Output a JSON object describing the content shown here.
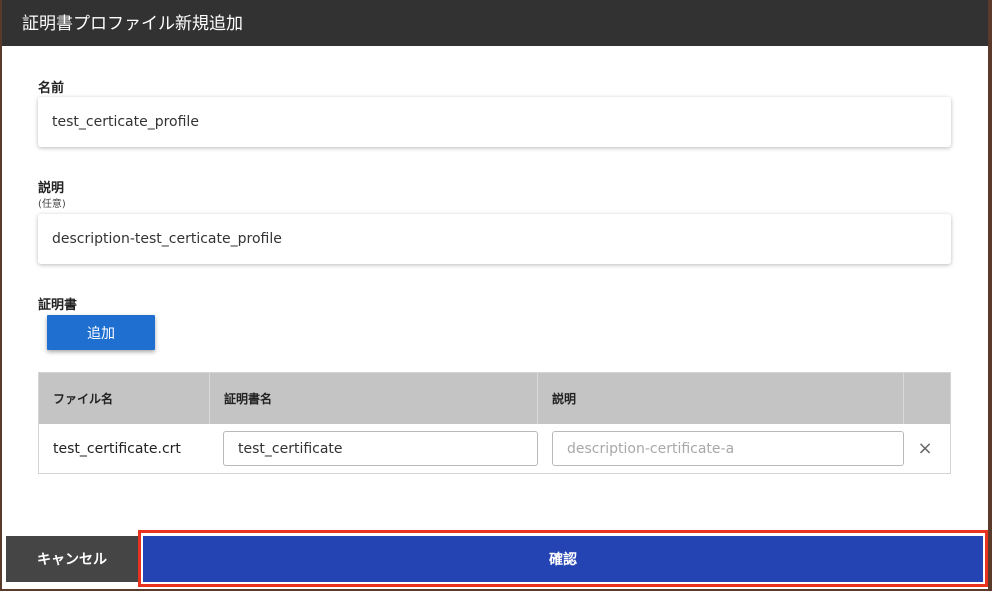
{
  "dialog": {
    "title": "証明書プロファイル新規追加"
  },
  "form": {
    "name": {
      "label": "名前",
      "value": "test_certicate_profile"
    },
    "description": {
      "label": "説明",
      "sublabel": "(任意)",
      "value": "description-test_certicate_profile"
    },
    "certificate": {
      "label": "証明書",
      "add_label": "追加"
    }
  },
  "table": {
    "headers": [
      "ファイル名",
      "証明書名",
      "説明"
    ],
    "rows": [
      {
        "file_name": "test_certificate.crt",
        "cert_name": "test_certificate",
        "description_placeholder": "description-certificate-a",
        "remove_icon": "×"
      }
    ]
  },
  "footer": {
    "cancel_label": "キャンセル",
    "confirm_label": "確認",
    "confirm_highlight_color": "#e8321f"
  },
  "colors": {
    "header_bg": "#323232",
    "add_button": "#1f6fd1",
    "confirm_button": "#2444b4",
    "cancel_button": "#454545"
  }
}
